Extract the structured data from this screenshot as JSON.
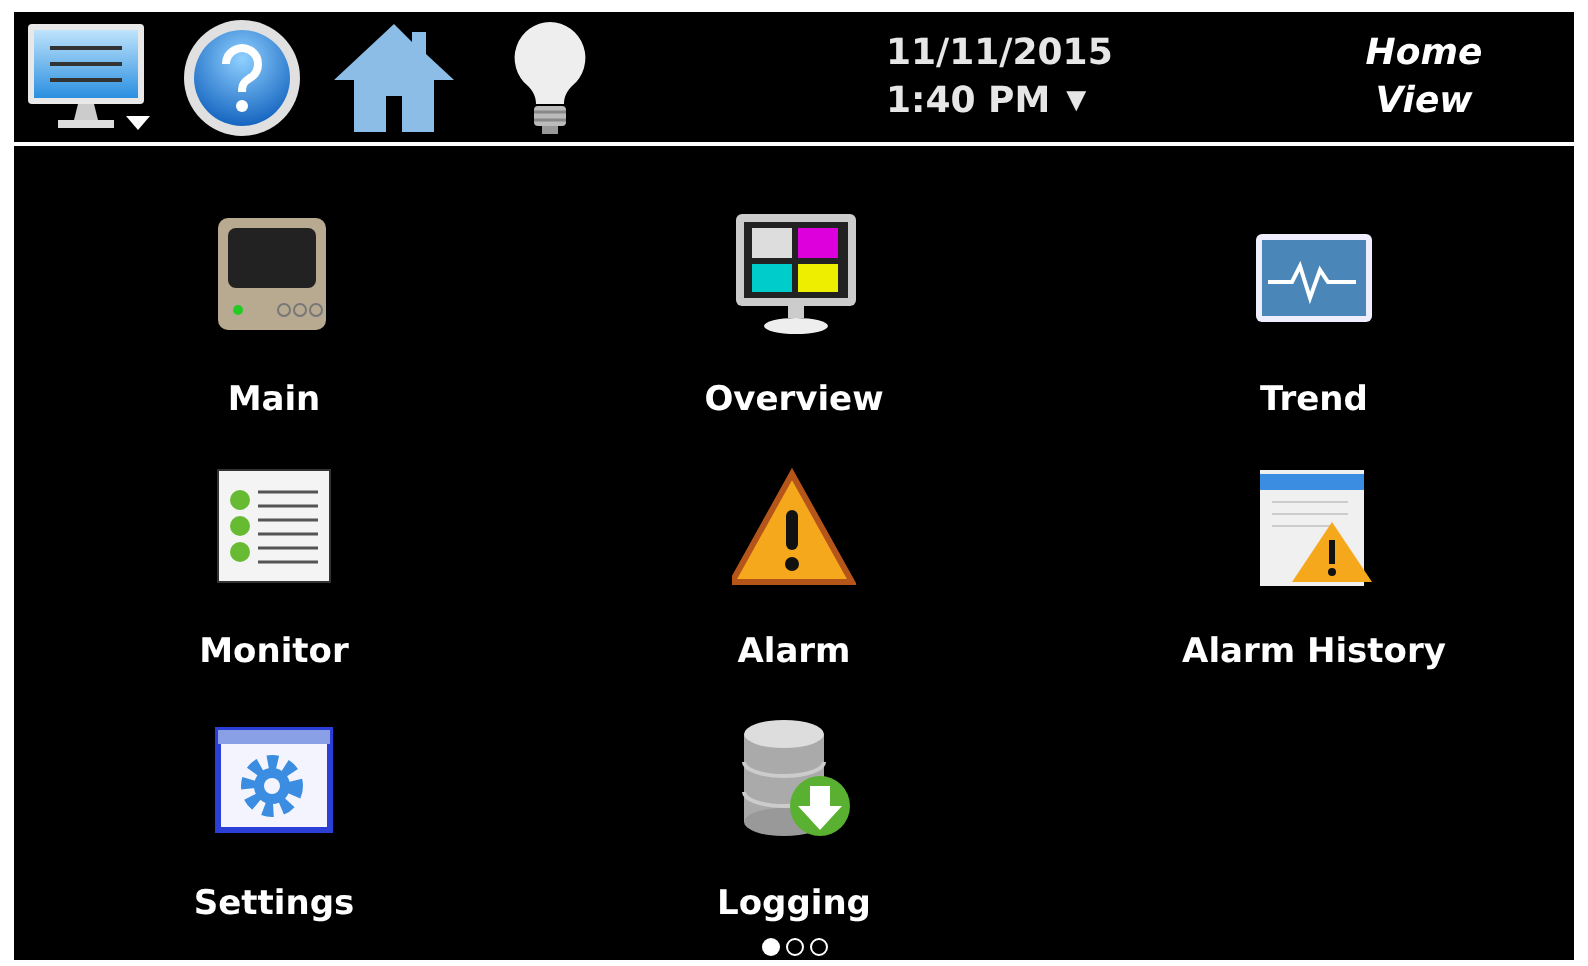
{
  "header": {
    "date": "11/11/2015",
    "time": "1:40 PM",
    "time_dropdown": "▼",
    "view_title": "Home View"
  },
  "launcher": [
    {
      "kind": "main",
      "label": "Main"
    },
    {
      "kind": "overview",
      "label": "Overview"
    },
    {
      "kind": "trend",
      "label": "Trend"
    },
    {
      "kind": "monitor",
      "label": "Monitor"
    },
    {
      "kind": "alarm",
      "label": "Alarm"
    },
    {
      "kind": "alarm_history",
      "label": "Alarm History"
    },
    {
      "kind": "settings",
      "label": "Settings"
    },
    {
      "kind": "logging",
      "label": "Logging"
    }
  ],
  "pages": [
    {
      "selected": true
    },
    {
      "selected": false
    },
    {
      "selected": false
    }
  ]
}
